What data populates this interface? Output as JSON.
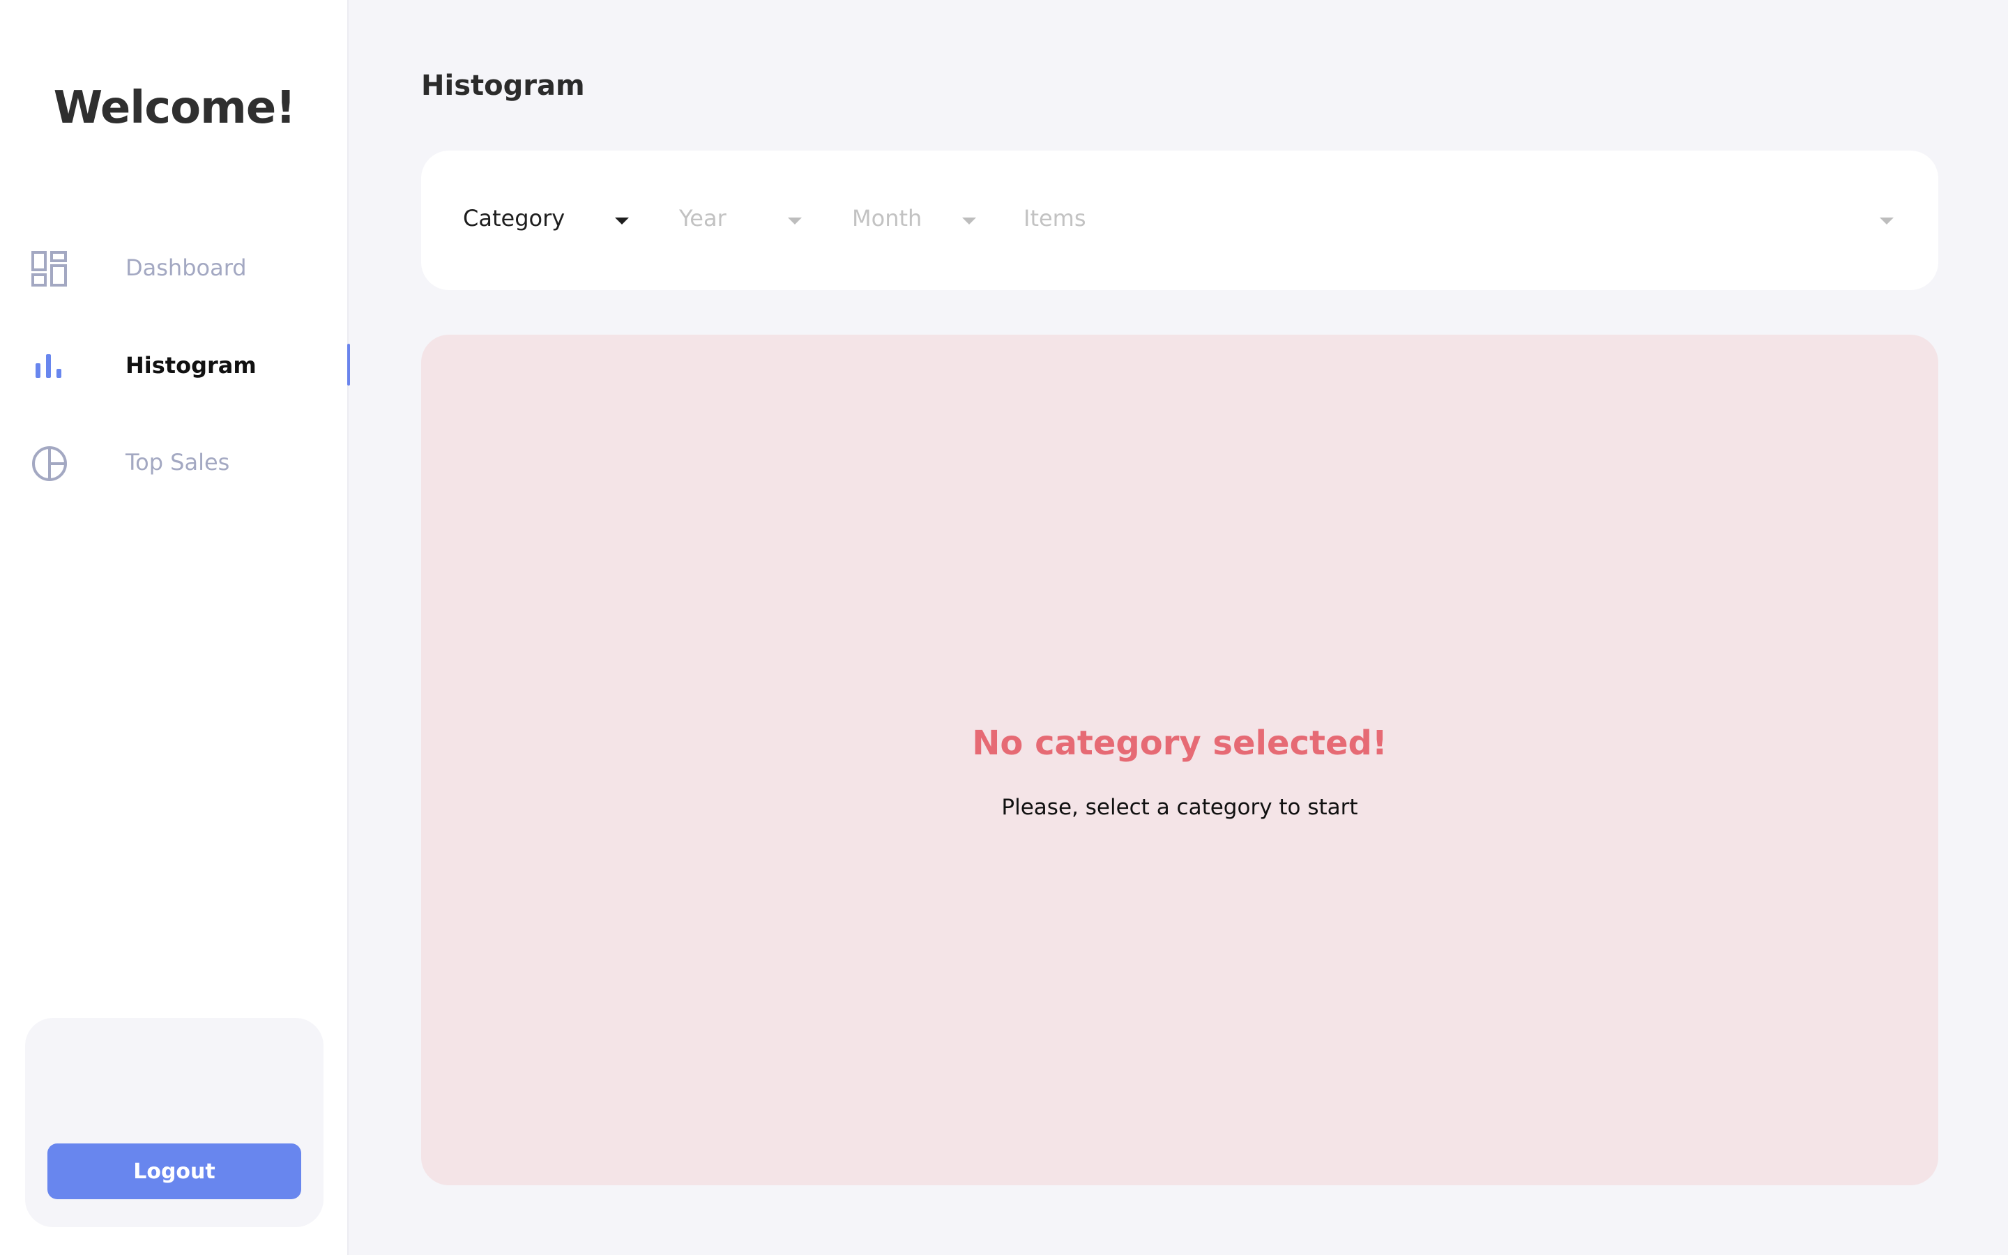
{
  "sidebar": {
    "welcome": "Welcome!",
    "items": [
      {
        "label": "Dashboard",
        "icon": "dashboard-icon"
      },
      {
        "label": "Histogram",
        "icon": "bar-chart-icon"
      },
      {
        "label": "Top Sales",
        "icon": "pie-chart-icon"
      }
    ],
    "active_item": "Histogram",
    "logout_label": "Logout"
  },
  "main": {
    "title": "Histogram",
    "filters": {
      "category": {
        "value": "Category",
        "enabled": true
      },
      "year": {
        "placeholder": "Year",
        "enabled": false
      },
      "month": {
        "placeholder": "Month",
        "enabled": false
      },
      "items": {
        "placeholder": "Items",
        "enabled": false
      }
    },
    "message": {
      "title": "No category selected!",
      "subtitle": "Please, select a category to start"
    }
  },
  "colors": {
    "accent": "#6886ee",
    "message_background": "#f4e4e7",
    "message_title": "#e66a74",
    "inactive_nav": "#a3a8c2"
  }
}
